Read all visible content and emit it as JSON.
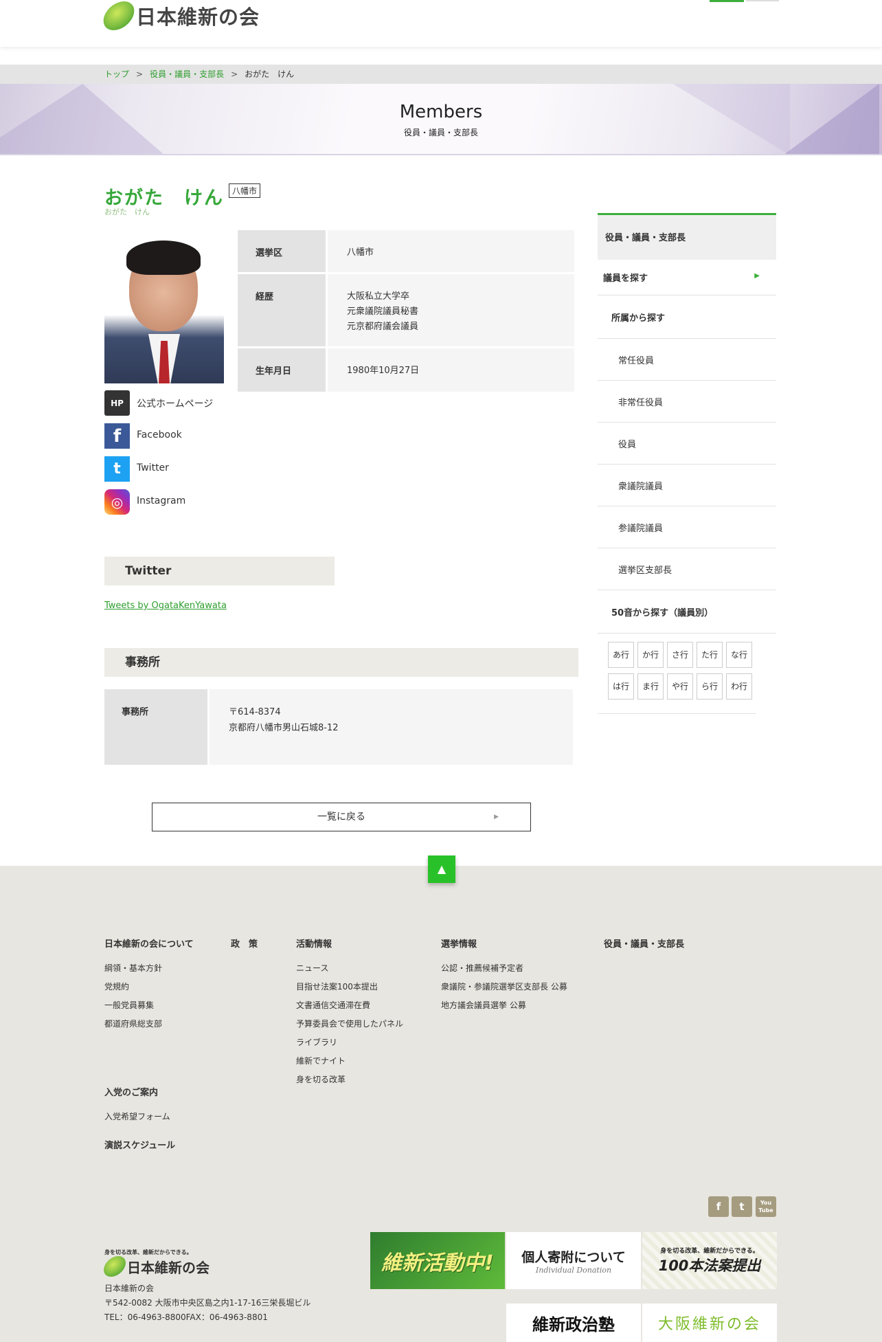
{
  "site": {
    "logo_text": "日本維新の会"
  },
  "breadcrumb": {
    "items": [
      "トップ",
      "役員・議員・支部長",
      "おがた　けん"
    ],
    "separator": ">"
  },
  "hero": {
    "title": "Members",
    "subtitle": "役員・議員・支部長"
  },
  "profile": {
    "name": "おがた　けん",
    "kana": "おがた　けん",
    "city_tag": "八幡市",
    "info": [
      {
        "key": "選挙区",
        "value": "八幡市"
      },
      {
        "key": "経歴",
        "lines": [
          "大阪私立大学卒",
          "元衆議院議員秘書",
          "元京都府議会議員"
        ]
      },
      {
        "key": "生年月日",
        "value": "1980年10月27日"
      }
    ],
    "links": [
      {
        "icon": "hp-icon",
        "icon_text": "HP",
        "label": "公式ホームページ",
        "color": "#333333"
      },
      {
        "icon": "facebook-icon",
        "icon_text": "f",
        "label": "Facebook",
        "color": "#3b5998"
      },
      {
        "icon": "twitter-icon",
        "icon_text": "t",
        "label": "Twitter",
        "color": "#1da1f2"
      },
      {
        "icon": "instagram-icon",
        "icon_text": "◎",
        "label": "Instagram",
        "color": "#d62976"
      }
    ]
  },
  "twitter_section": {
    "heading": "Twitter",
    "link_text": "Tweets by OgataKenYawata"
  },
  "office_section": {
    "heading": "事務所",
    "key": "事務所",
    "lines": [
      "〒614-8374",
      "京都府八幡市男山石城8-12"
    ]
  },
  "back_button": {
    "label": "一覧に戻る",
    "arrow": "▶"
  },
  "to_top": "▲",
  "sidebar": {
    "title": "役員・議員・支部長",
    "search_label": "議員を探す",
    "search_arrow": "▶",
    "affiliation_label": "所属から探す",
    "affiliation_items": [
      "常任役員",
      "非常任役員",
      "役員",
      "衆議院議員",
      "参議院議員",
      "選挙区支部長"
    ],
    "kana_label": "50音から探す（議員別）",
    "kana_buttons": [
      "あ行",
      "か行",
      "さ行",
      "た行",
      "な行",
      "は行",
      "ま行",
      "や行",
      "ら行",
      "わ行"
    ]
  },
  "footer": {
    "about": {
      "heading": "日本維新の会について",
      "items": [
        "綱領・基本方針",
        "党規約",
        "一般党員募集",
        "都道府県総支部"
      ]
    },
    "policy": {
      "heading": "政　策"
    },
    "activity": {
      "heading": "活動情報",
      "items": [
        "ニュース",
        "目指せ法案100本提出",
        "文書通信交通滞在費",
        "予算委員会で使用したパネル",
        "ライブラリ",
        "維新でナイト",
        "身を切る改革"
      ]
    },
    "election": {
      "heading": "選挙情報",
      "items": [
        "公認・推薦候補予定者",
        "衆議院・参議院選挙区支部長 公募",
        "地方議会議員選挙 公募"
      ]
    },
    "members": {
      "heading": "役員・議員・支部長"
    },
    "join": {
      "heading": "入党のご案内",
      "items": [
        "入党希望フォーム"
      ]
    },
    "speech": {
      "heading": "演説スケジュール"
    },
    "social": [
      {
        "icon": "facebook-icon",
        "text": "f"
      },
      {
        "icon": "twitter-icon",
        "text": "t"
      },
      {
        "icon": "youtube-icon",
        "text": "You Tube"
      }
    ],
    "logo_tagline": "身を切る改革、維新だからできる。",
    "logo_text": "日本維新の会",
    "org_name": "日本維新の会",
    "address": "〒542-0082 大阪市中央区島之内1-17-16三栄長堀ビル",
    "tel": "TEL：06-4963-8800FAX：06-4963-8801",
    "banners": {
      "activity": "維新活動中!",
      "donation": "個人寄附について",
      "donation_en": "Individual Donation",
      "bills_tagline": "身を切る改革、維新だからできる。",
      "bills": "100本法案提出",
      "school": "維新政治塾",
      "osaka": "大阪維新の会"
    }
  }
}
